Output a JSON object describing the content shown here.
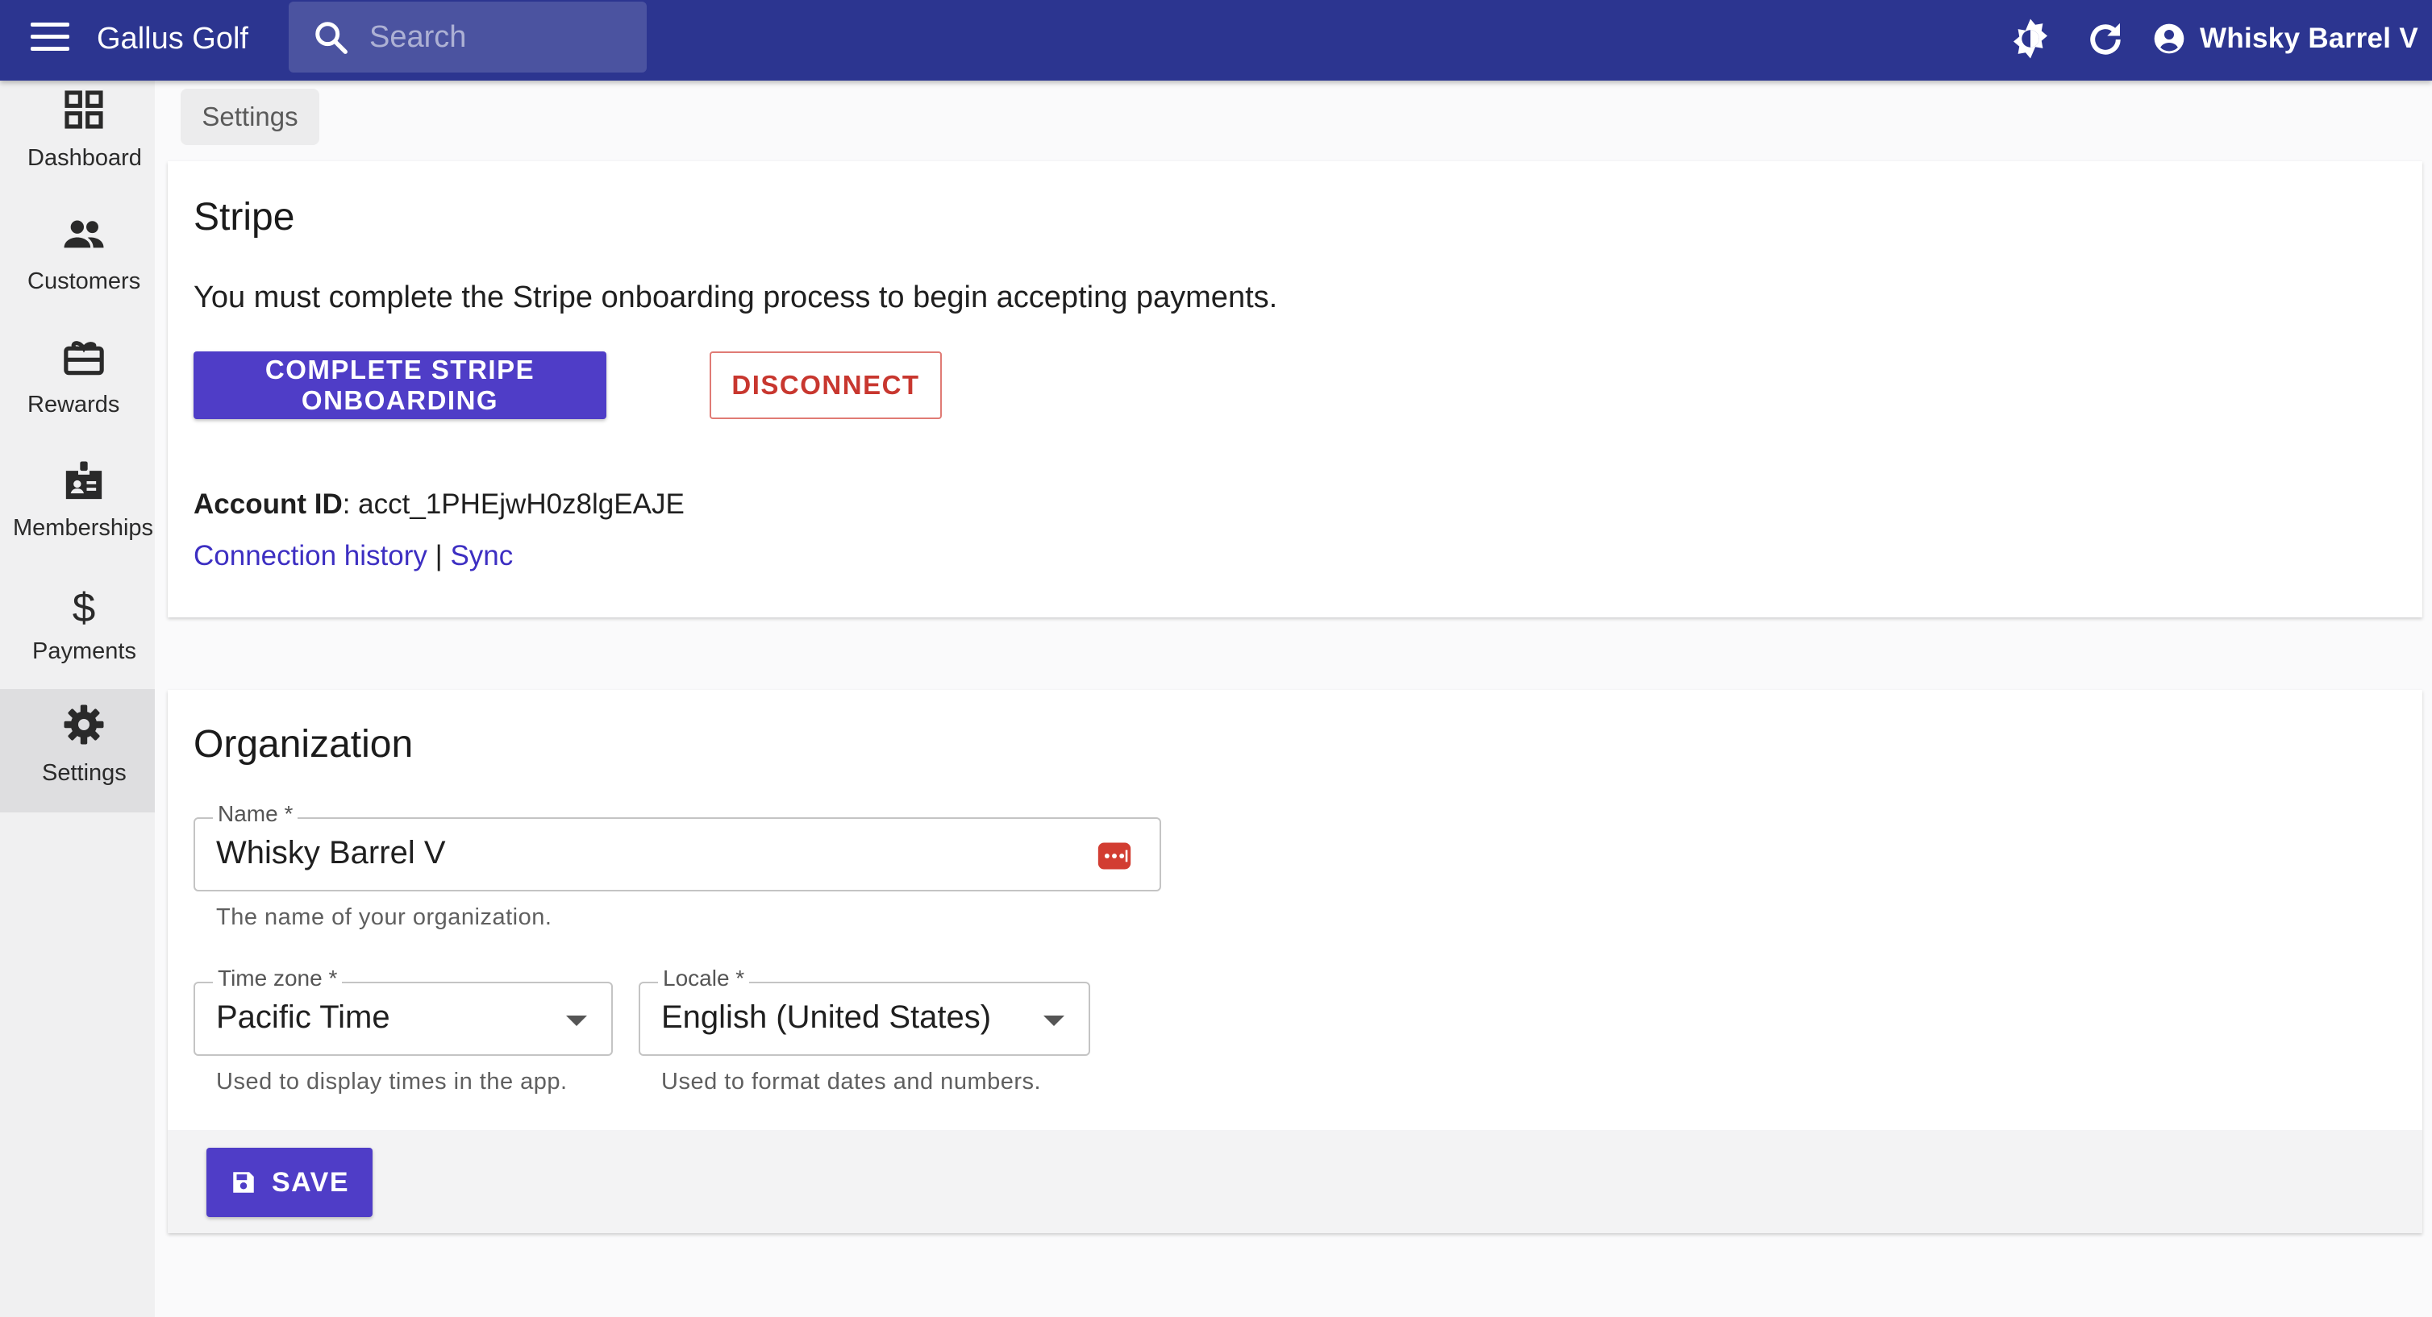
{
  "appbar": {
    "title": "Gallus Golf",
    "search_placeholder": "Search",
    "user_name": "Whisky Barrel V",
    "color": "#2c3590"
  },
  "sidebar": {
    "items": [
      {
        "label": "Dashboard",
        "icon": "dashboard-icon"
      },
      {
        "label": "Customers",
        "icon": "people-icon"
      },
      {
        "label": "Rewards",
        "icon": "gift-card-icon"
      },
      {
        "label": "Memberships",
        "icon": "id-badge-icon"
      },
      {
        "label": "Payments",
        "icon": "dollar-icon"
      },
      {
        "label": "Settings",
        "icon": "gear-icon",
        "active": true
      }
    ]
  },
  "breadcrumb": "Settings",
  "stripe": {
    "title": "Stripe",
    "message": "You must complete the Stripe onboarding process to begin accepting payments.",
    "onboard_label": "COMPLETE STRIPE ONBOARDING",
    "disconnect_label": "DISCONNECT",
    "account_label": "Account ID",
    "account_id": ": acct_1PHEjwH0z8lgEAJE",
    "history_link": "Connection history",
    "separator": " | ",
    "sync_link": "Sync"
  },
  "organization": {
    "title": "Organization",
    "name_label": "Name *",
    "name_value": "Whisky Barrel V",
    "name_helper": "The name of your organization.",
    "timezone_label": "Time zone *",
    "timezone_value": "Pacific Time",
    "timezone_helper": "Used to display times in the app.",
    "locale_label": "Locale *",
    "locale_value": "English (United States)",
    "locale_helper": "Used to format dates and numbers.",
    "save_label": "SAVE"
  },
  "colors": {
    "primary": "#4f3dc7",
    "danger": "#c8372f",
    "link": "#3d2fc2"
  }
}
